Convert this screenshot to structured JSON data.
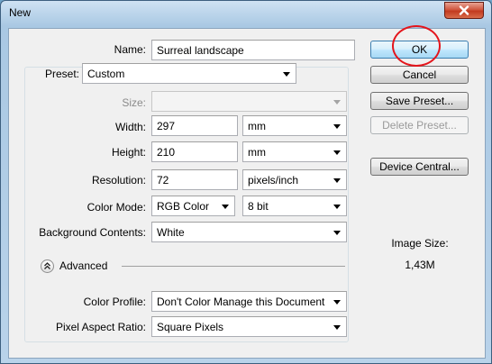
{
  "window": {
    "title": "New"
  },
  "form": {
    "name": {
      "label": "Name:",
      "value": "Surreal landscape"
    },
    "preset": {
      "label": "Preset:",
      "value": "Custom"
    },
    "size": {
      "label": "Size:",
      "value": ""
    },
    "width": {
      "label": "Width:",
      "value": "297",
      "unit": "mm"
    },
    "height": {
      "label": "Height:",
      "value": "210",
      "unit": "mm"
    },
    "resolution": {
      "label": "Resolution:",
      "value": "72",
      "unit": "pixels/inch"
    },
    "color_mode": {
      "label": "Color Mode:",
      "value": "RGB Color",
      "depth": "8 bit"
    },
    "background": {
      "label": "Background Contents:",
      "value": "White"
    },
    "advanced": {
      "label": "Advanced"
    },
    "color_profile": {
      "label": "Color Profile:",
      "value": "Don't Color Manage this Document"
    },
    "pixel_aspect": {
      "label": "Pixel Aspect Ratio:",
      "value": "Square Pixels"
    }
  },
  "buttons": {
    "ok": "OK",
    "cancel": "Cancel",
    "save_preset": "Save Preset...",
    "delete_preset": "Delete Preset...",
    "device_central": "Device Central..."
  },
  "image_size": {
    "label": "Image Size:",
    "value": "1,43M"
  },
  "colors": {
    "annotation_circle": "#e4151c",
    "title_bar": "#a9c8e3",
    "close_button": "#c23a1f"
  },
  "icons": {
    "close": "close-icon",
    "advanced_toggle": "chevron-up-double-icon",
    "dropdown": "dropdown-arrow-icon"
  }
}
